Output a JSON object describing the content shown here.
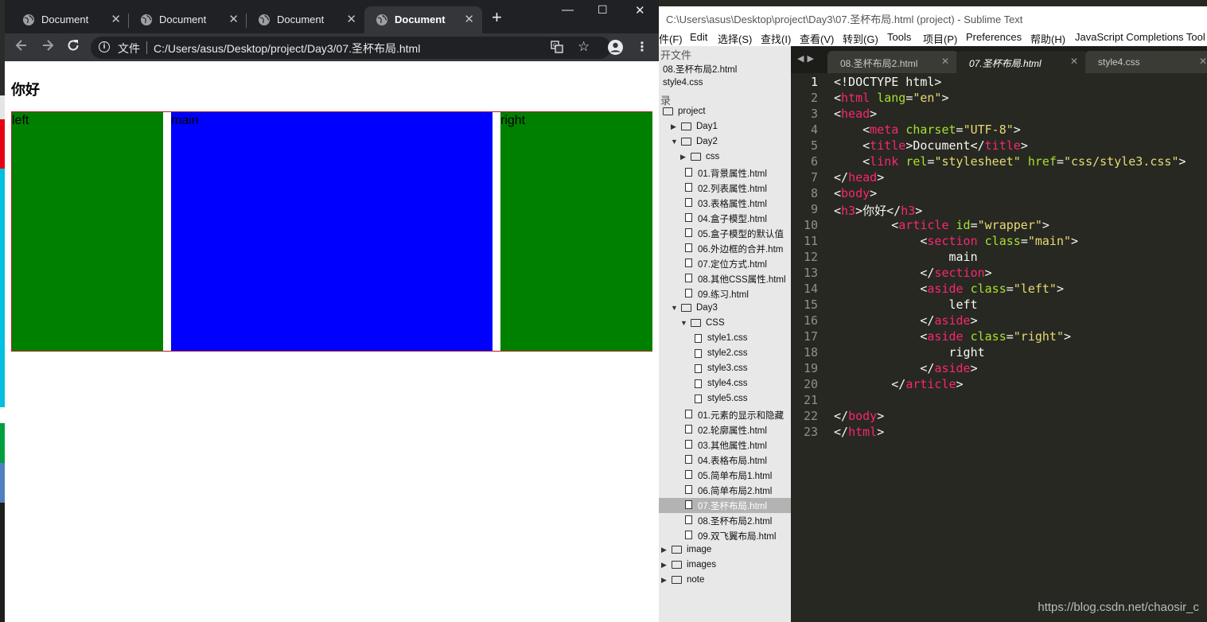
{
  "chrome": {
    "tabs": [
      {
        "title": "Document",
        "active": false
      },
      {
        "title": "Document",
        "active": false
      },
      {
        "title": "Document",
        "active": false
      },
      {
        "title": "Document",
        "active": true
      }
    ],
    "new_tab": "+",
    "window_controls": {
      "minimize": "—",
      "maximize": "☐",
      "close": "✕"
    },
    "address": {
      "scheme_label": "文件",
      "url": "C:/Users/asus/Desktop/project/Day3/07.圣杯布局.html"
    },
    "page": {
      "heading": "你好",
      "columns": [
        {
          "name": "left",
          "text": "left",
          "color": "#008000"
        },
        {
          "name": "main",
          "text": "main",
          "color": "#0000ff"
        },
        {
          "name": "right",
          "text": "right",
          "color": "#008000"
        }
      ],
      "wrapper_border_color": "#b22222"
    }
  },
  "sublime": {
    "title": "C:\\Users\\asus\\Desktop\\project\\Day3\\07.圣杯布局.html (project) - Sublime Text",
    "menu": [
      "件(F)",
      "Edit",
      "选择(S)",
      "查找(I)",
      "查看(V)",
      "转到(G)",
      "Tools",
      "项目(P)",
      "Preferences",
      "帮助(H)",
      "JavaScript Completions Tool"
    ],
    "sidebar": {
      "open_files_heading": "开文件",
      "open_files": [
        "08.圣杯布局2.html",
        "style4.css"
      ],
      "folders_heading": "录",
      "tree": [
        {
          "label": "project",
          "type": "folder-open",
          "depth": 0
        },
        {
          "label": "Day1",
          "type": "folder",
          "depth": 1
        },
        {
          "label": "Day2",
          "type": "folder-open",
          "depth": 1
        },
        {
          "label": "css",
          "type": "folder",
          "depth": 2
        },
        {
          "label": "01.背景属性.html",
          "type": "file",
          "depth": 2
        },
        {
          "label": "02.列表属性.html",
          "type": "file",
          "depth": 2
        },
        {
          "label": "03.表格属性.html",
          "type": "file",
          "depth": 2
        },
        {
          "label": "04.盒子模型.html",
          "type": "file",
          "depth": 2
        },
        {
          "label": "05.盒子模型的默认值",
          "type": "file",
          "depth": 2
        },
        {
          "label": "06.外边框的合并.htm",
          "type": "file",
          "depth": 2
        },
        {
          "label": "07.定位方式.html",
          "type": "file",
          "depth": 2
        },
        {
          "label": "08.其他CSS属性.html",
          "type": "file",
          "depth": 2
        },
        {
          "label": "09.练习.html",
          "type": "file",
          "depth": 2
        },
        {
          "label": "Day3",
          "type": "folder-open",
          "depth": 1
        },
        {
          "label": "CSS",
          "type": "folder-open",
          "depth": 2
        },
        {
          "label": "style1.css",
          "type": "file",
          "depth": 3
        },
        {
          "label": "style2.css",
          "type": "file",
          "depth": 3
        },
        {
          "label": "style3.css",
          "type": "file",
          "depth": 3
        },
        {
          "label": "style4.css",
          "type": "file",
          "depth": 3
        },
        {
          "label": "style5.css",
          "type": "file",
          "depth": 3
        },
        {
          "label": "01.元素的显示和隐藏",
          "type": "file",
          "depth": 2
        },
        {
          "label": "02.轮廓属性.html",
          "type": "file",
          "depth": 2
        },
        {
          "label": "03.其他属性.html",
          "type": "file",
          "depth": 2
        },
        {
          "label": "04.表格布局.html",
          "type": "file",
          "depth": 2
        },
        {
          "label": "05.简单布局1.html",
          "type": "file",
          "depth": 2
        },
        {
          "label": "06.简单布局2.html",
          "type": "file",
          "depth": 2
        },
        {
          "label": "07.圣杯布局.html",
          "type": "file",
          "depth": 2,
          "selected": true
        },
        {
          "label": "08.圣杯布局2.html",
          "type": "file",
          "depth": 2
        },
        {
          "label": "09.双飞翼布局.html",
          "type": "file",
          "depth": 2
        },
        {
          "label": "image",
          "type": "folder",
          "depth": 0
        },
        {
          "label": "images",
          "type": "folder",
          "depth": 0
        },
        {
          "label": "note",
          "type": "folder",
          "depth": 0
        }
      ]
    },
    "tabs": [
      {
        "title": "08.圣杯布局2.html",
        "active": false
      },
      {
        "title": "07.圣杯布局.html",
        "active": true
      },
      {
        "title": "style4.css",
        "active": false
      }
    ],
    "code_lines": [
      "<!DOCTYPE html>",
      "<html lang=\"en\">",
      "<head>",
      "    <meta charset=\"UTF-8\">",
      "    <title>Document</title>",
      "    <link rel=\"stylesheet\" href=\"css/style3.css\">",
      "</head>",
      "<body>",
      "<h3>你好</h3>",
      "        <article id=\"wrapper\">",
      "            <section class=\"main\">",
      "                main",
      "            </section>",
      "            <aside class=\"left\">",
      "                left",
      "            </aside>",
      "            <aside class=\"right\">",
      "                right",
      "            </aside>",
      "        </article>",
      "",
      "</body>",
      "</html>"
    ],
    "watermark": "https://blog.csdn.net/chaosir_c"
  }
}
